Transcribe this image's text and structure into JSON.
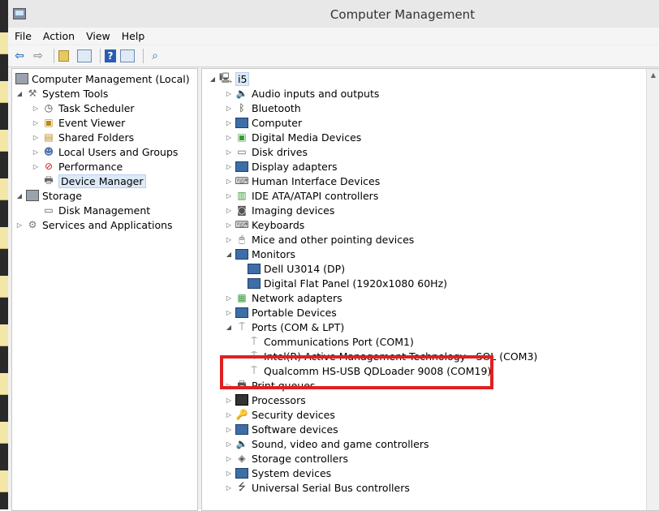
{
  "window": {
    "title": "Computer Management"
  },
  "menu": [
    "File",
    "Action",
    "View",
    "Help"
  ],
  "toolbar": {
    "icons": [
      "back-arrow-icon",
      "forward-arrow-icon",
      "up-folder-icon",
      "show-hide-tree-icon",
      "help-icon",
      "properties-icon",
      "scan-hardware-icon"
    ]
  },
  "left_tree": {
    "root": "Computer Management (Local)",
    "system_tools": "System Tools",
    "task_scheduler": "Task Scheduler",
    "event_viewer": "Event Viewer",
    "shared_folders": "Shared Folders",
    "local_users": "Local Users and Groups",
    "performance": "Performance",
    "device_manager": "Device Manager",
    "storage": "Storage",
    "disk_management": "Disk Management",
    "services": "Services and Applications"
  },
  "device_tree": {
    "root": "i5",
    "items": [
      "Audio inputs and outputs",
      "Bluetooth",
      "Computer",
      "Digital Media Devices",
      "Disk drives",
      "Display adapters",
      "Human Interface Devices",
      "IDE ATA/ATAPI controllers",
      "Imaging devices",
      "Keyboards",
      "Mice and other pointing devices",
      "Monitors",
      "Dell U3014 (DP)",
      "Digital Flat Panel (1920x1080 60Hz)",
      "Network adapters",
      "Portable Devices",
      "Ports (COM & LPT)",
      "Communications Port (COM1)",
      "Intel(R) Active Management Technology - SOL (COM3)",
      "Qualcomm HS-USB QDLoader 9008 (COM19)",
      "Print queues",
      "Processors",
      "Security devices",
      "Software devices",
      "Sound, video and game controllers",
      "Storage controllers",
      "System devices",
      "Universal Serial Bus controllers"
    ]
  },
  "colors": {
    "highlight_box": "#e02020",
    "selection": "#dde9f8"
  }
}
